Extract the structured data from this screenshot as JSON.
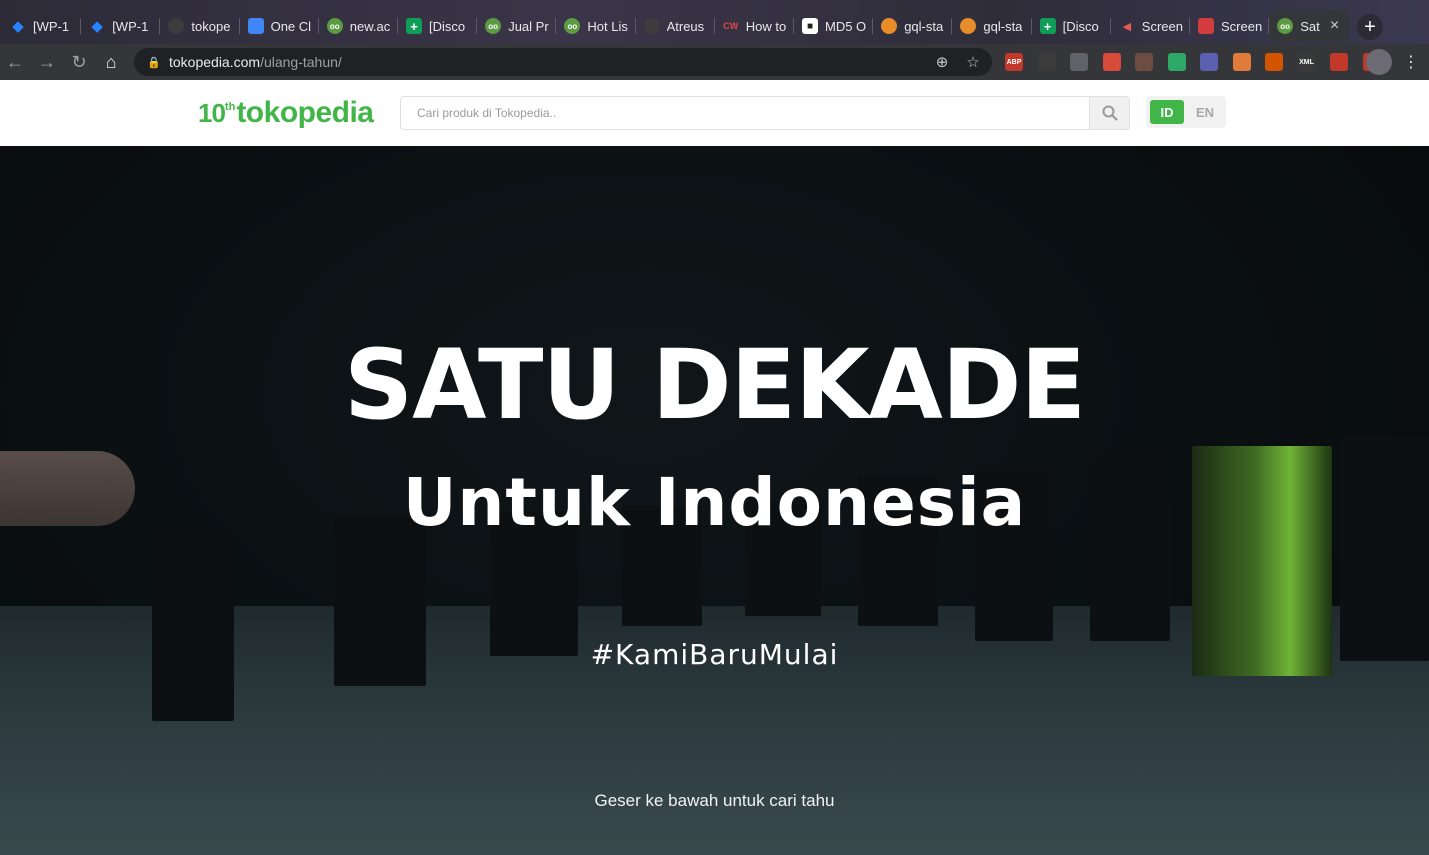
{
  "browser": {
    "tabs": [
      {
        "label": "[WP-1",
        "icon": "jira-icon"
      },
      {
        "label": "[WP-1",
        "icon": "jira-icon"
      },
      {
        "label": "tokope",
        "icon": "github-icon"
      },
      {
        "label": "One Cl",
        "icon": "google-docs-icon"
      },
      {
        "label": "new.ac",
        "icon": "tokopedia-icon"
      },
      {
        "label": "[Disco",
        "icon": "google-sheets-icon"
      },
      {
        "label": "Jual Pr",
        "icon": "tokopedia-icon"
      },
      {
        "label": "Hot Lis",
        "icon": "tokopedia-icon"
      },
      {
        "label": "Atreus",
        "icon": "github-icon"
      },
      {
        "label": "How to",
        "icon": "cw-icon"
      },
      {
        "label": "MD5 O",
        "icon": "lock-icon"
      },
      {
        "label": "gql-sta",
        "icon": "graphql-icon"
      },
      {
        "label": "gql-sta",
        "icon": "graphql-icon"
      },
      {
        "label": "[Disco",
        "icon": "google-sheets-icon"
      },
      {
        "label": "Screen",
        "icon": "screencast-icon"
      },
      {
        "label": "Screen",
        "icon": "screenshot-icon"
      },
      {
        "label": "Sat",
        "icon": "tokopedia-icon",
        "active": true
      }
    ],
    "address": {
      "domain": "tokopedia.com",
      "path": "/ulang-tahun/"
    },
    "extensions": [
      "ABP",
      "",
      "",
      "",
      "",
      "",
      "",
      "",
      "",
      "XML",
      "",
      "RE"
    ]
  },
  "site": {
    "logo": {
      "ten": "10",
      "th": "th",
      "name": "tokopedia"
    },
    "search": {
      "placeholder": "Cari produk di Tokopedia.."
    },
    "lang": {
      "id": "ID",
      "en": "EN"
    }
  },
  "hero": {
    "title": "SATU DEKADE",
    "subtitle": "Untuk Indonesia",
    "hashtag": "#KamiBaruMulai",
    "scroll_hint": "Geser ke bawah untuk cari tahu"
  },
  "colors": {
    "brand_green": "#42b549",
    "tab_bg": "#2d2b38",
    "toolbar_bg": "#35363a",
    "hero_bg": "#0a0f12"
  }
}
